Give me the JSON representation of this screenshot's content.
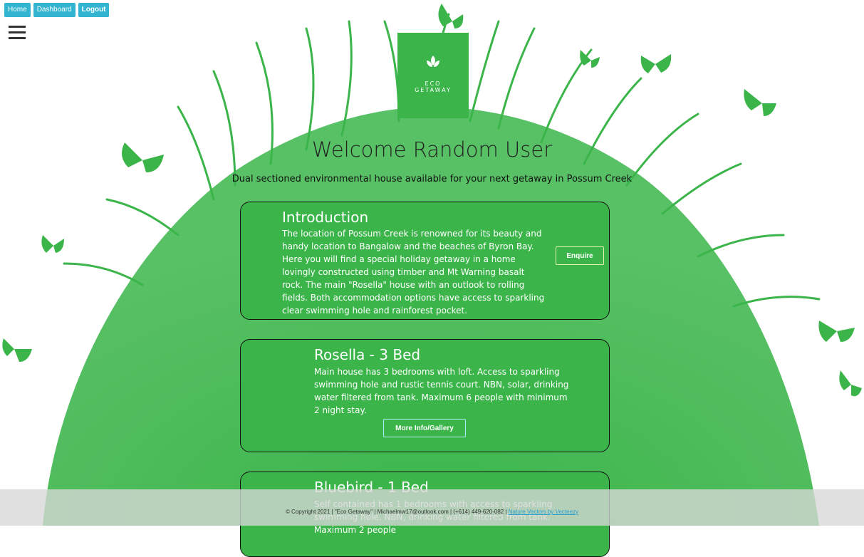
{
  "nav": {
    "home": "Home",
    "dashboard": "Dashboard",
    "logout": "Logout"
  },
  "logo": {
    "line1": "ECO",
    "line2": "GETAWAY",
    "color": "#3bb54a"
  },
  "welcome": "Welcome Random User",
  "subtitle": "Dual sectioned environmental house available for your next getaway in Possum Creek",
  "cards": {
    "intro": {
      "title": "Introduction",
      "text": "The location of Possum Creek is renowned for its beauty and handy location to Bangalow and the beaches of Byron Bay. Here you will find a special holiday getaway in a home lovingly constructed using timber and Mt Warning basalt rock. The main \"Rosella\" house with an outlook to rolling fields. Both accommodation options have access to sparkling clear swimming hole and rainforest pocket.",
      "button": "Enquire"
    },
    "rosella": {
      "title": "Rosella - 3 Bed",
      "text": "Main house has 3 bedrooms with loft. Access to sparkling swimming hole and rustic tennis court. NBN, solar, drinking water filtered from tank. Maximum 6 people with minimum 2 night stay.",
      "button": "More Info/Gallery"
    },
    "bluebird": {
      "title": "Bluebird - 1 Bed",
      "text": "Self contained has 1 bedrooms with access to sparkling swimming hole. NBN, drinking water filtered from tank. Maximum 2 people"
    }
  },
  "footer": {
    "text": "© Copyright 2021 | \"Eco Getaway\" | Michaelmw17@outlook.com | (+614) 449-620-082 | ",
    "credit": "Nature Vectors by Vecteezy"
  },
  "colors": {
    "accent_green": "#3bb54a",
    "nav_blue": "#33b5d1"
  }
}
